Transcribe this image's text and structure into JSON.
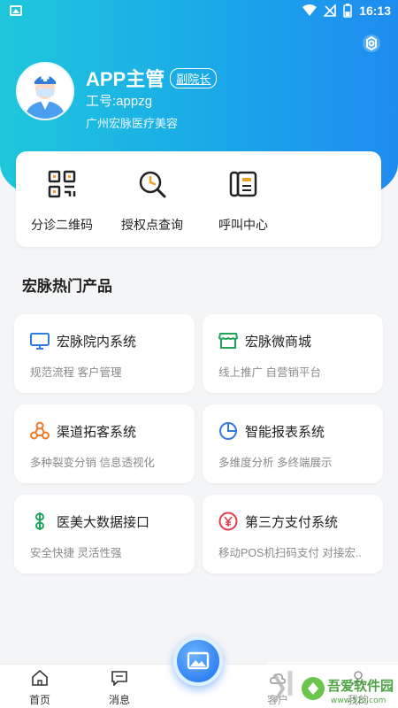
{
  "status_bar": {
    "time": "16:13",
    "battery": "1"
  },
  "profile": {
    "name": "APP主管",
    "role_badge": "副院长",
    "job_number": "工号:appzg",
    "company": "广州宏脉医疗美容"
  },
  "quick_actions": [
    {
      "label": "分诊二维码",
      "icon": "qr-code-icon"
    },
    {
      "label": "授权点查询",
      "icon": "search-clock-icon"
    },
    {
      "label": "呼叫中心",
      "icon": "phone-book-icon"
    }
  ],
  "section_title": "宏脉热门产品",
  "products": [
    {
      "name": "宏脉院内系统",
      "desc": "规范流程 客户管理",
      "icon": "monitor-icon",
      "color": "#2f7de1"
    },
    {
      "name": "宏脉微商城",
      "desc": "线上推广 自营销平台",
      "icon": "shop-icon",
      "color": "#1fa35a"
    },
    {
      "name": "渠道拓客系统",
      "desc": "多种裂变分销 信息透视化",
      "icon": "network-icon",
      "color": "#f07a2a"
    },
    {
      "name": "智能报表系统",
      "desc": "多维度分析 多终端展示",
      "icon": "pie-chart-icon",
      "color": "#2f7de1"
    },
    {
      "name": "医美大数据接口",
      "desc": "安全快捷 灵活性强",
      "icon": "data-link-icon",
      "color": "#1fa35a"
    },
    {
      "name": "第三方支付系统",
      "desc": "移动POS机扫码支付 对接宏..",
      "icon": "yen-icon",
      "color": "#e23b4a"
    }
  ],
  "tabs": [
    {
      "label": "首页",
      "icon": "home-icon"
    },
    {
      "label": "消息",
      "icon": "message-icon"
    },
    {
      "label": "客户",
      "icon": "cloud-icon"
    },
    {
      "label": "我的",
      "icon": "user-icon"
    }
  ],
  "watermark": {
    "text1": "吾爱软件园",
    "text2": "www.52z.com"
  }
}
